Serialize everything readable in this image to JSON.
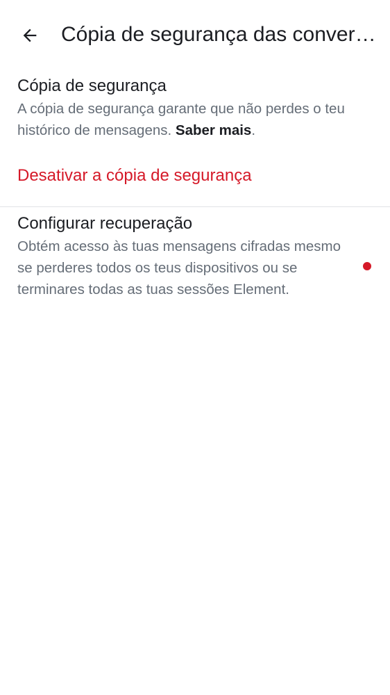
{
  "header": {
    "title": "Cópia de segurança das conversas",
    "back_icon": "arrow-left-icon"
  },
  "backup": {
    "title": "Cópia de segurança",
    "description": "A cópia de segurança garante que não perdes o teu histórico de mensagens.",
    "learn_more": "Saber mais",
    "learn_more_suffix": ".",
    "disable_label": "Desativar a cópia de segurança"
  },
  "recovery": {
    "title": "Configurar recuperação",
    "description": "Obtém acesso às tuas mensagens cifradas mesmo se perderes todos os teus dispositivos ou se terminares todas as tuas sessões Element.",
    "indicator_icon": "red-dot-indicator-icon"
  },
  "colors": {
    "text_primary": "#1b1d22",
    "text_secondary": "#656d77",
    "critical": "#d51928",
    "divider": "#e1e3e6",
    "background": "#ffffff"
  }
}
